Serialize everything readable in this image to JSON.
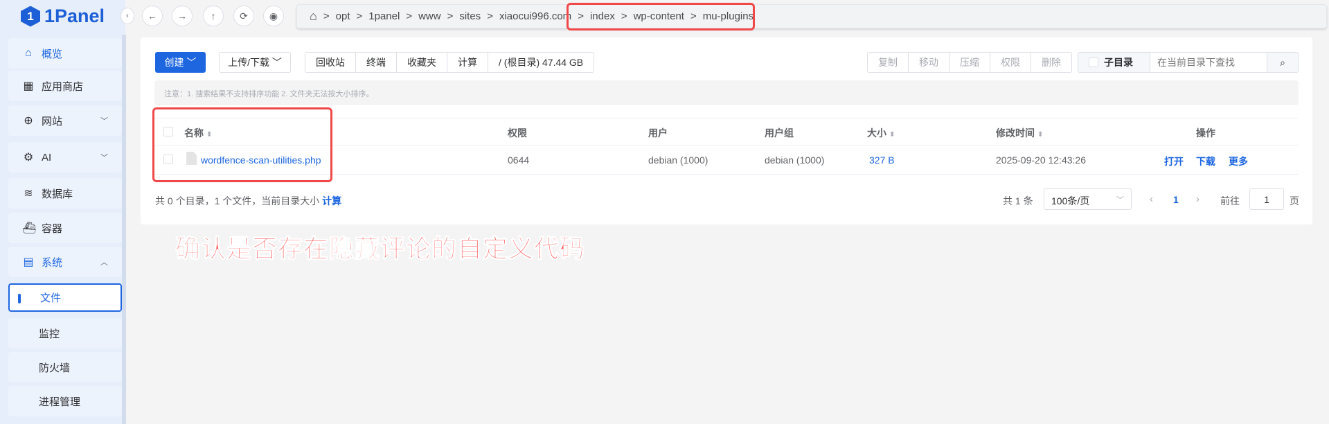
{
  "logo": "1Panel",
  "sidebar": {
    "items": [
      {
        "label": "概览",
        "icon": "home-icon"
      },
      {
        "label": "应用商店",
        "icon": "grid-icon"
      },
      {
        "label": "网站",
        "icon": "globe-icon"
      },
      {
        "label": "AI",
        "icon": "robot-icon"
      },
      {
        "label": "数据库",
        "icon": "layers-icon"
      },
      {
        "label": "容器",
        "icon": "docker-icon"
      },
      {
        "label": "系统",
        "icon": "server-icon"
      },
      {
        "label": "文件"
      },
      {
        "label": "监控"
      },
      {
        "label": "防火墙"
      },
      {
        "label": "进程管理"
      }
    ]
  },
  "breadcrumb": [
    "opt",
    "1panel",
    "www",
    "sites",
    "xiaocui996.com",
    "index",
    "wp-content",
    "mu-plugins"
  ],
  "toolbar": {
    "create": "创建",
    "upload": "上传/下载",
    "group": [
      "回收站",
      "终端",
      "收藏夹",
      "计算",
      "/ (根目录) 47.44 GB"
    ],
    "actions": [
      "复制",
      "移动",
      "压缩",
      "权限",
      "删除"
    ],
    "subdir": "子目录",
    "search_placeholder": "在当前目录下查找"
  },
  "notice": "注意：1. 搜索结果不支持排序功能 2. 文件夹无法按大小排序。",
  "table": {
    "headers": [
      "名称",
      "权限",
      "用户",
      "用户组",
      "大小",
      "修改时间",
      "操作"
    ],
    "rows": [
      {
        "name": "wordfence-scan-utilities.php",
        "perm": "0644",
        "user": "debian (1000)",
        "group": "debian (1000)",
        "size": "327 B",
        "mtime": "2025-09-20 12:43:26",
        "ops": [
          "打开",
          "下载",
          "更多"
        ]
      }
    ]
  },
  "footer": {
    "summary": "共 0 个目录，1 个文件，当前目录大小",
    "calc": "计算"
  },
  "pagination": {
    "total": "共 1 条",
    "page_size": "100条/页",
    "current": "1",
    "goto": "前往",
    "goto_value": "1",
    "page_unit": "页"
  },
  "annotation": "确认是否存在隐藏评论的自定义代码"
}
